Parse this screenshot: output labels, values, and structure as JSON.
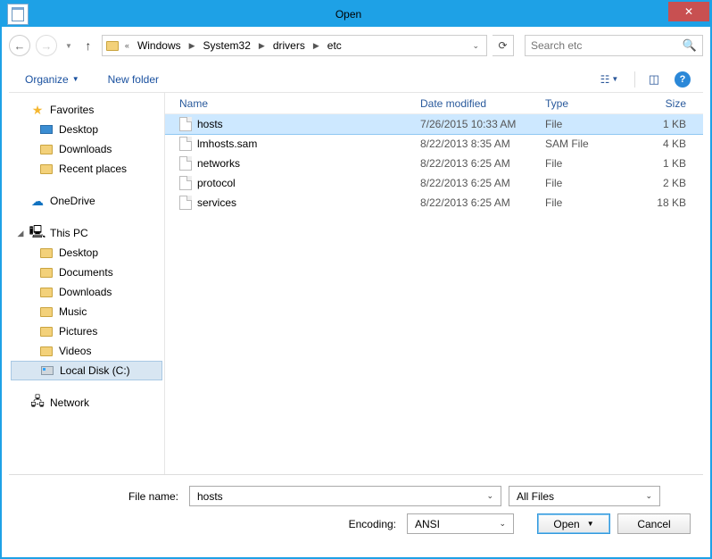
{
  "title": "Open",
  "breadcrumb": {
    "pre": "«",
    "p1": "Windows",
    "p2": "System32",
    "p3": "drivers",
    "p4": "etc"
  },
  "search": {
    "placeholder": "Search etc"
  },
  "toolbar": {
    "organize": "Organize",
    "newfolder": "New folder"
  },
  "columns": {
    "name": "Name",
    "date": "Date modified",
    "type": "Type",
    "size": "Size"
  },
  "sidebar": {
    "favorites": "Favorites",
    "desktop": "Desktop",
    "downloads": "Downloads",
    "recent": "Recent places",
    "onedrive": "OneDrive",
    "thispc": "This PC",
    "pc_desktop": "Desktop",
    "pc_documents": "Documents",
    "pc_downloads": "Downloads",
    "pc_music": "Music",
    "pc_pictures": "Pictures",
    "pc_videos": "Videos",
    "pc_disk": "Local Disk (C:)",
    "network": "Network"
  },
  "files": [
    {
      "name": "hosts",
      "date": "7/26/2015 10:33 AM",
      "type": "File",
      "size": "1 KB",
      "selected": true
    },
    {
      "name": "lmhosts.sam",
      "date": "8/22/2013 8:35 AM",
      "type": "SAM File",
      "size": "4 KB",
      "selected": false
    },
    {
      "name": "networks",
      "date": "8/22/2013 6:25 AM",
      "type": "File",
      "size": "1 KB",
      "selected": false
    },
    {
      "name": "protocol",
      "date": "8/22/2013 6:25 AM",
      "type": "File",
      "size": "2 KB",
      "selected": false
    },
    {
      "name": "services",
      "date": "8/22/2013 6:25 AM",
      "type": "File",
      "size": "18 KB",
      "selected": false
    }
  ],
  "footer": {
    "filename_label": "File name:",
    "filename_value": "hosts",
    "filter_value": "All Files",
    "encoding_label": "Encoding:",
    "encoding_value": "ANSI",
    "open": "Open",
    "cancel": "Cancel"
  }
}
